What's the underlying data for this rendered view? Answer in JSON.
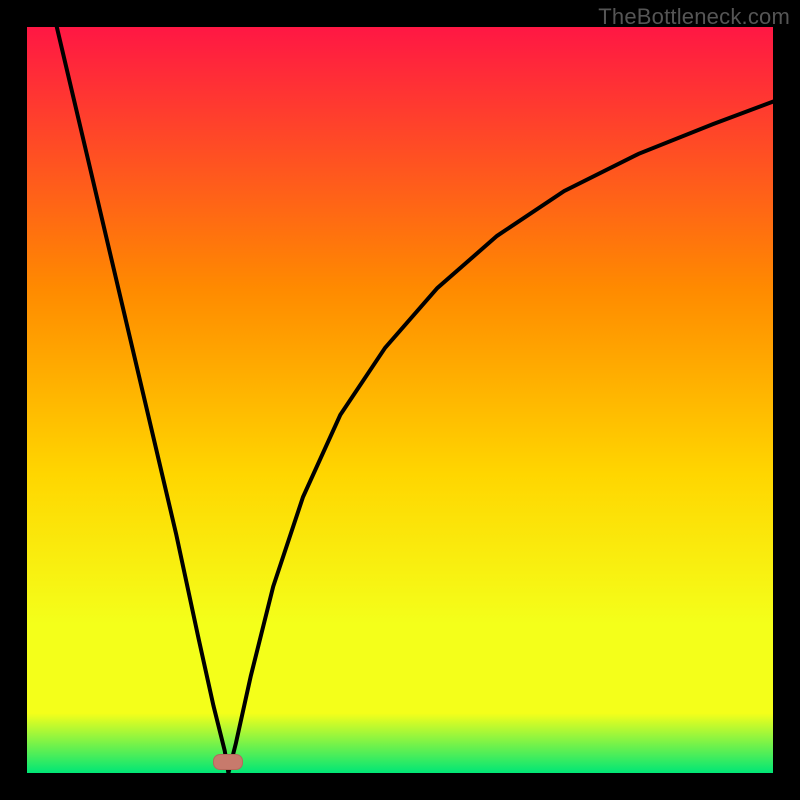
{
  "watermark": "TheBottleneck.com",
  "colors": {
    "frame_bg": "#000000",
    "gradient_top": "#ff1744",
    "gradient_mid1": "#ff8a00",
    "gradient_mid2": "#ffd600",
    "gradient_mid3": "#f4ff1a",
    "gradient_bottom": "#00e676",
    "curve": "#000000",
    "marker": "#c77a6c",
    "marker_border": "#b36a5c"
  },
  "chart_data": {
    "type": "line",
    "title": "",
    "xlabel": "",
    "ylabel": "",
    "xlim": [
      0,
      100
    ],
    "ylim": [
      0,
      100
    ],
    "grid": false,
    "legend": false,
    "annotations": [],
    "marker": {
      "x": 27,
      "y": 1.5,
      "shape": "rounded-rect",
      "color_key": "marker"
    },
    "series": [
      {
        "name": "left-branch",
        "x": [
          4,
          8,
          12,
          16,
          20,
          23,
          25,
          26.5,
          27
        ],
        "values": [
          100,
          83,
          66,
          49,
          32,
          18,
          9,
          3,
          0
        ]
      },
      {
        "name": "right-branch",
        "x": [
          27,
          28,
          30,
          33,
          37,
          42,
          48,
          55,
          63,
          72,
          82,
          92,
          100
        ],
        "values": [
          0,
          4,
          13,
          25,
          37,
          48,
          57,
          65,
          72,
          78,
          83,
          87,
          90
        ]
      }
    ]
  }
}
